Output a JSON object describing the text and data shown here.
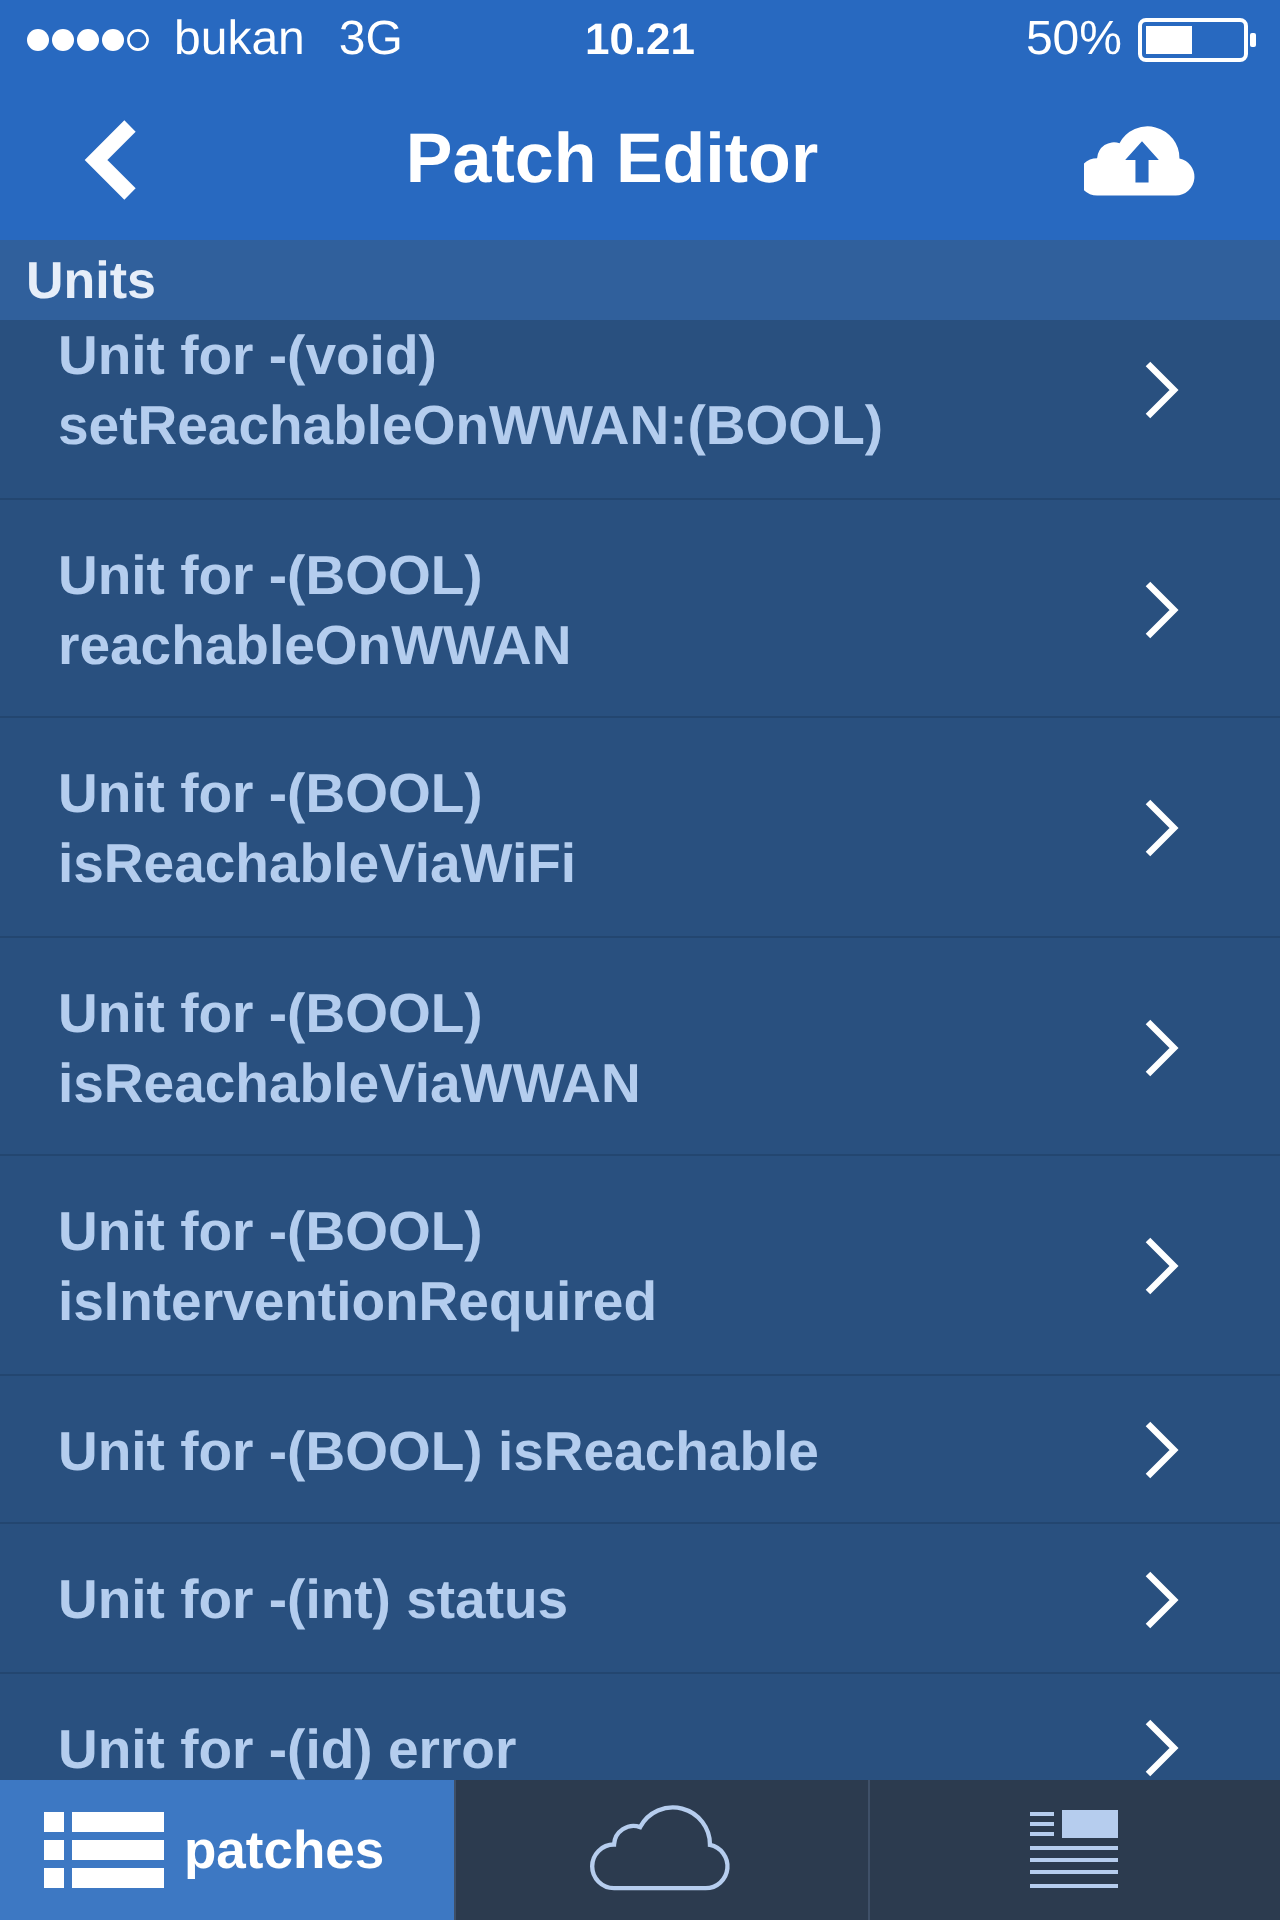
{
  "status_bar": {
    "carrier": "bukan",
    "network": "3G",
    "time": "10.21",
    "battery": "50%"
  },
  "nav_bar": {
    "title": "Patch Editor"
  },
  "section": {
    "title": "Units",
    "items": [
      {
        "title": "Unit for -(void) setReachableOnWWAN:(BOOL)"
      },
      {
        "title": "Unit for -(BOOL) reachableOnWWAN"
      },
      {
        "title": "Unit for -(BOOL) isReachableViaWiFi"
      },
      {
        "title": "Unit for -(BOOL) isReachableViaWWAN"
      },
      {
        "title": "Unit for -(BOOL) isInterventionRequired"
      },
      {
        "title": "Unit for -(BOOL) isReachable"
      },
      {
        "title": "Unit for -(int) status"
      },
      {
        "title": "Unit for -(id) error"
      }
    ]
  },
  "tab_bar": {
    "tabs": [
      {
        "label": "patches",
        "selected": true
      },
      {
        "selected": false
      },
      {
        "selected": false
      }
    ]
  }
}
